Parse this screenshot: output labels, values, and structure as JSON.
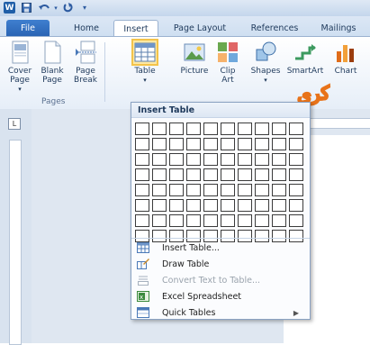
{
  "qat": {
    "app_logo": "W",
    "save_icon": "save-icon",
    "undo_icon": "undo-icon",
    "redo_icon": "redo-icon"
  },
  "tabs": [
    {
      "label": "File"
    },
    {
      "label": "Home"
    },
    {
      "label": "Insert"
    },
    {
      "label": "Page Layout"
    },
    {
      "label": "References"
    },
    {
      "label": "Mailings"
    }
  ],
  "ribbon": {
    "cover_page": "Cover Page",
    "cover_page_arrow": "▾",
    "blank_page": "Blank Page",
    "page_break": "Page Break",
    "pages_group": "Pages",
    "table": "Table",
    "table_arrow": "▾",
    "picture": "Picture",
    "clip_art": "Clip Art",
    "shapes": "Shapes",
    "shapes_arrow": "▾",
    "smartart": "SmartArt",
    "chart": "Chart"
  },
  "ruler": {
    "tab_selector": "L"
  },
  "dropdown": {
    "header": "Insert Table",
    "grid_rows": 8,
    "grid_cols": 10,
    "items": [
      {
        "label": "Insert Table...",
        "icon": "insert-table-icon",
        "enabled": true
      },
      {
        "label": "Draw Table",
        "icon": "draw-table-icon",
        "enabled": true
      },
      {
        "label": "Convert Text to Table...",
        "icon": "convert-text-icon",
        "enabled": false
      },
      {
        "label": "Excel Spreadsheet",
        "icon": "excel-icon",
        "enabled": true
      },
      {
        "label": "Quick Tables",
        "icon": "quick-tables-icon",
        "enabled": true,
        "submenu": true
      }
    ]
  },
  "watermark": {
    "text": "ﮐﺮﯼ"
  },
  "colors": {
    "accent": "#2a64b4",
    "selection": "#fde8a3",
    "selection_border": "#f3c34a",
    "watermark_stroke": "#e8731a"
  }
}
